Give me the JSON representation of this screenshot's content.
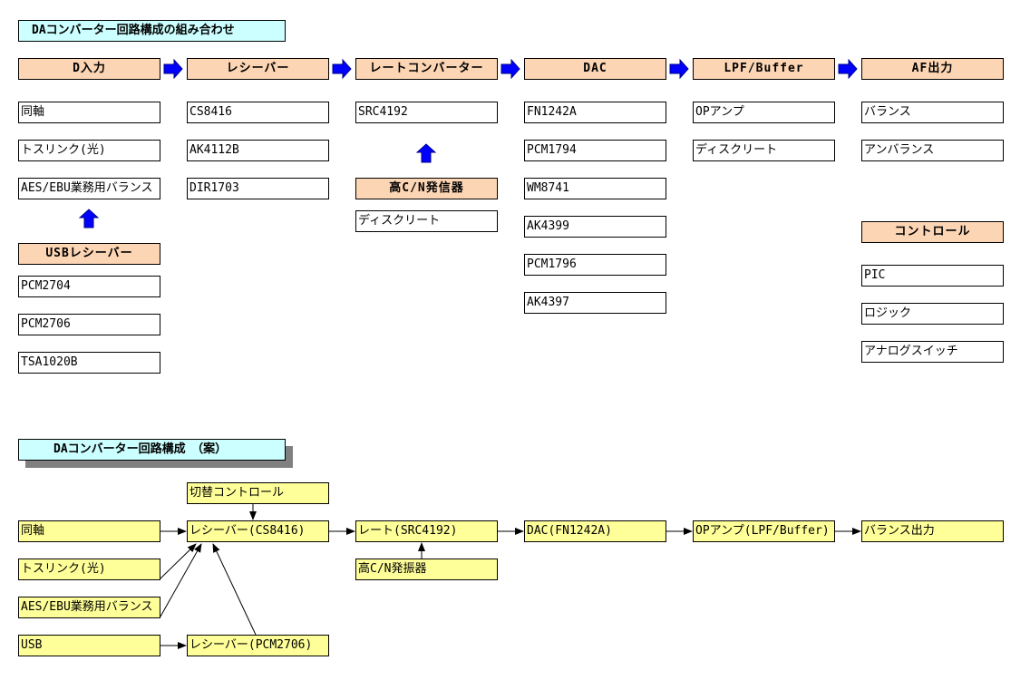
{
  "top": {
    "title": "DAコンバーター回路構成の組み合わせ",
    "columns": [
      {
        "header": "D入力",
        "items": [
          "同軸",
          "トスリンク(光)",
          "AES/EBU業務用バランス"
        ]
      },
      {
        "header": "レシーバー",
        "items": [
          "CS8416",
          "AK4112B",
          "DIR1703"
        ]
      },
      {
        "header": "レートコンバーター",
        "items": [
          "SRC4192"
        ]
      },
      {
        "header": "DAC",
        "items": [
          "FN1242A",
          "PCM1794",
          "WM8741",
          "AK4399",
          "PCM1796",
          "AK4397"
        ]
      },
      {
        "header": "LPF/Buffer",
        "items": [
          "OPアンプ",
          "ディスクリート"
        ]
      },
      {
        "header": "AF出力",
        "items": [
          "バランス",
          "アンバランス"
        ]
      }
    ],
    "usb": {
      "header": "USBレシーバー",
      "items": [
        "PCM2704",
        "PCM2706",
        "TSA1020B"
      ]
    },
    "oscillator": {
      "header": "高C/N発信器",
      "items": [
        "ディスクリート"
      ]
    },
    "control": {
      "header": "コントロール",
      "items": [
        "PIC",
        "ロジック",
        "アナログスイッチ"
      ]
    }
  },
  "plan": {
    "title": "DAコンバーター回路構成　（案）",
    "switch_control": "切替コントロール",
    "inputs": [
      "同軸",
      "トスリンク(光)",
      "AES/EBU業務用バランス",
      "USB"
    ],
    "receiver": "レシーバー(CS8416)",
    "usb_receiver": "レシーバー(PCM2706)",
    "rate": "レート(SRC4192)",
    "oscillator": "高C/N発振器",
    "dac": "DAC(FN1242A)",
    "opamp": "OPアンプ(LPF/Buffer)",
    "output": "バランス出力"
  },
  "colors": {
    "header": "#fcd5b4",
    "title": "#ccffff",
    "plan_box": "#ffff99",
    "flow_arrow": "#0000ff"
  }
}
